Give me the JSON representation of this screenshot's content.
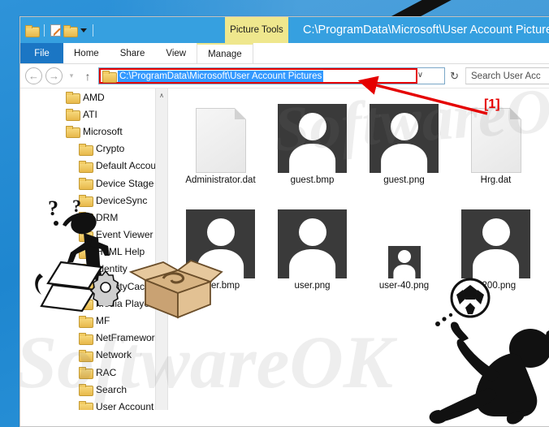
{
  "window": {
    "title": "C:\\ProgramData\\Microsoft\\User Account Pictures",
    "picture_tools_label": "Picture Tools"
  },
  "quick_access_toolbar": {
    "items": [
      {
        "name": "folder-icon",
        "label": "Folder"
      },
      {
        "name": "properties-icon",
        "label": "Properties"
      },
      {
        "name": "new-folder-icon",
        "label": "New folder"
      },
      {
        "name": "customize-caret-icon",
        "label": "Customize Quick Access Toolbar"
      }
    ]
  },
  "ribbon": {
    "tabs": [
      {
        "label": "File",
        "active": true
      },
      {
        "label": "Home",
        "active": false
      },
      {
        "label": "Share",
        "active": false
      },
      {
        "label": "View",
        "active": false
      },
      {
        "label": "Manage",
        "active": false
      }
    ]
  },
  "address_bar": {
    "back_glyph": "←",
    "forward_glyph": "→",
    "recent_glyph": "▾",
    "up_glyph": "↑",
    "path_text": "C:\\ProgramData\\Microsoft\\User Account Pictures",
    "dropdown_glyph": "∨",
    "refresh_glyph": "↻",
    "highlight_color": "#e50000",
    "selection_color": "#3399ff"
  },
  "search": {
    "text": "Search User Acc",
    "placeholder": "Search User Account Pictures"
  },
  "nav_pane": {
    "items": [
      {
        "label": "AMD",
        "level": 1
      },
      {
        "label": "ATI",
        "level": 1
      },
      {
        "label": "Microsoft",
        "level": 1
      },
      {
        "label": "Crypto",
        "level": 2
      },
      {
        "label": "Default Accou",
        "level": 2
      },
      {
        "label": "Device Stage",
        "level": 2
      },
      {
        "label": "DeviceSync",
        "level": 2
      },
      {
        "label": "DRM",
        "level": 2
      },
      {
        "label": "Event Viewer",
        "level": 2
      },
      {
        "label": "HTML Help",
        "level": 2
      },
      {
        "label": "Identity",
        "level": 2
      },
      {
        "label": "IdentityCache",
        "level": 2
      },
      {
        "label": "Media Player",
        "level": 2
      },
      {
        "label": "MF",
        "level": 2
      },
      {
        "label": "NetFramework",
        "level": 2
      },
      {
        "label": "Network",
        "level": 2
      },
      {
        "label": "RAC",
        "level": 2
      },
      {
        "label": "Search",
        "level": 2
      },
      {
        "label": "User Account",
        "level": 2
      }
    ],
    "scroll_up_glyph": "∧"
  },
  "files": [
    {
      "name": "Administrator.dat",
      "type": "dat",
      "size": "large"
    },
    {
      "name": "guest.bmp",
      "type": "avatar",
      "size": "large"
    },
    {
      "name": "guest.png",
      "type": "avatar",
      "size": "large"
    },
    {
      "name": "Hrg.dat",
      "type": "dat",
      "size": "large"
    },
    {
      "name": "user.bmp",
      "type": "avatar",
      "size": "large"
    },
    {
      "name": "user.png",
      "type": "avatar",
      "size": "large"
    },
    {
      "name": "user-40.png",
      "type": "avatar",
      "size": "small"
    },
    {
      "name": "r-200.png",
      "type": "avatar",
      "size": "large"
    }
  ],
  "annotations": {
    "marker_1": "[1]",
    "marker_color": "#e50000"
  },
  "watermark": {
    "text_1": "SoftwareOK",
    "text_2": "SoftwareOK"
  },
  "clipart": {
    "thinker": "stick-figure-thinking",
    "box": "open-cardboard-box",
    "gear": "gear-icon",
    "papers": "loose-papers",
    "question_marks": "question-mark",
    "soccer_player": "soccer-player-silhouette",
    "soccer_ball": "soccer-ball"
  }
}
